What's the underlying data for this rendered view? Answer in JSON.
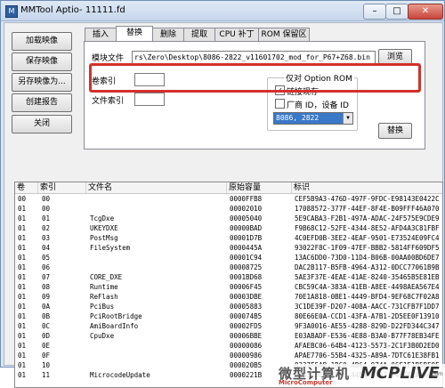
{
  "window": {
    "title": "MMTool Aptio- 11111.fd",
    "min_icon": "minimize-icon",
    "max_icon": "maximize-icon",
    "close_icon": "close-icon",
    "min_glyph": "–",
    "max_glyph": "□",
    "close_glyph": "✕"
  },
  "left_buttons": {
    "load": "加载映像",
    "save": "保存映像",
    "save_as": "另存映像为...",
    "report": "创建报告",
    "close": "关闭"
  },
  "tabs": [
    "插入",
    "替换",
    "删除",
    "提取",
    "CPU 补丁",
    "ROM 保留区"
  ],
  "active_tab": "替换",
  "replace_panel": {
    "module_file_label": "模块文件",
    "module_file_value": "rs\\Zero\\Desktop\\8086-2822_v11601702_mod_for_P67+Z68.bin",
    "browse_button": "浏览",
    "volume_index_label": "卷索引",
    "file_index_label": "文件索引",
    "option_rom_group_label": "仅对 Option ROM",
    "link_present_label": "链接现存",
    "link_present_checked": true,
    "vendor_device_label": "厂商 ID，设备 ID",
    "vendor_device_checked": false,
    "vendor_device_select": "8086, 2822",
    "replace_button": "替换"
  },
  "table": {
    "columns": [
      "卷",
      "索引",
      "文件名",
      "原始容量",
      "标识"
    ],
    "rows": [
      [
        "00",
        "00",
        "",
        "0000FFB8",
        "CEF5B9A3-476D-497F-9FDC-E98143E0422C"
      ],
      [
        "01",
        "00",
        "",
        "00002010",
        "17088572-377F-44EF-8F4E-B09FFF46A070"
      ],
      [
        "01",
        "01",
        "TcgDxe",
        "00005040",
        "5E9CABA3-F2B1-497A-ADAC-24F575E9CDE9"
      ],
      [
        "01",
        "02",
        "UKEYDXE",
        "00000BAD",
        "F9B68C12-52FE-4344-8E52-AFD4A3C81FBF"
      ],
      [
        "01",
        "03",
        "PostMsg",
        "00001D7B",
        "4C0EFD0B-3EE2-4EAF-9501-E73524E09FC4"
      ],
      [
        "01",
        "04",
        "FileSystem",
        "0000445A",
        "93022F8C-1F09-47EF-BBB2-5814FF609DF5"
      ],
      [
        "01",
        "05",
        "",
        "00001C94",
        "13AC6DD0-73D0-11D4-B06B-00AA00BD6DE7"
      ],
      [
        "01",
        "06",
        "",
        "00008725",
        "DAC2B117-B5FB-4964-A312-0DCC77061B9B"
      ],
      [
        "01",
        "07",
        "CORE_DXE",
        "0001BD68",
        "5AE3F37E-4EAE-41AE-8240-35465B5E81EB"
      ],
      [
        "01",
        "08",
        "Runtime",
        "00006F45",
        "CBC59C4A-383A-41EB-A8EE-4498AEA567E4"
      ],
      [
        "01",
        "09",
        "ReFlash",
        "00003DBE",
        "70E1A818-0BE1-4449-BFD4-9EF68C7F02A8"
      ],
      [
        "01",
        "0A",
        "PciBus",
        "00005883",
        "3C1DE39F-D207-408A-AACC-731CFB7F1DD7"
      ],
      [
        "01",
        "0B",
        "PciRootBridge",
        "000074B5",
        "80E66E0A-CCD1-43FA-A7B1-2D5EE0F13910"
      ],
      [
        "01",
        "0C",
        "AmiBoardInfo",
        "00002FD5",
        "9F3A0016-AE55-4288-829D-D22FD344C347"
      ],
      [
        "01",
        "0D",
        "CpuDxe",
        "00006BBE",
        "E03ABADF-E536-4E88-B3A0-B77F78EB34FE"
      ],
      [
        "01",
        "0E",
        "",
        "00000086",
        "AFAEBC06-64B4-4123-5573-2C1F3B0D2ED0"
      ],
      [
        "01",
        "0F",
        "",
        "00000986",
        "APAE7706-55B4-4325-A89A-7DTC61E38FB1"
      ],
      [
        "01",
        "10",
        "",
        "000020B5",
        "8337F5AB-1BC0-4B64-974A-06F1E1B5BF8F"
      ],
      [
        "01",
        "11",
        "MicrocodeUpdate",
        "0000221B",
        "F3331DE6-4A55-44E4-B767-7453F7A1A021"
      ]
    ]
  },
  "watermark": {
    "cn": "微型计算机",
    "en": "MicroComputer",
    "logo": "MCPLIVE",
    "sub": ".com"
  }
}
